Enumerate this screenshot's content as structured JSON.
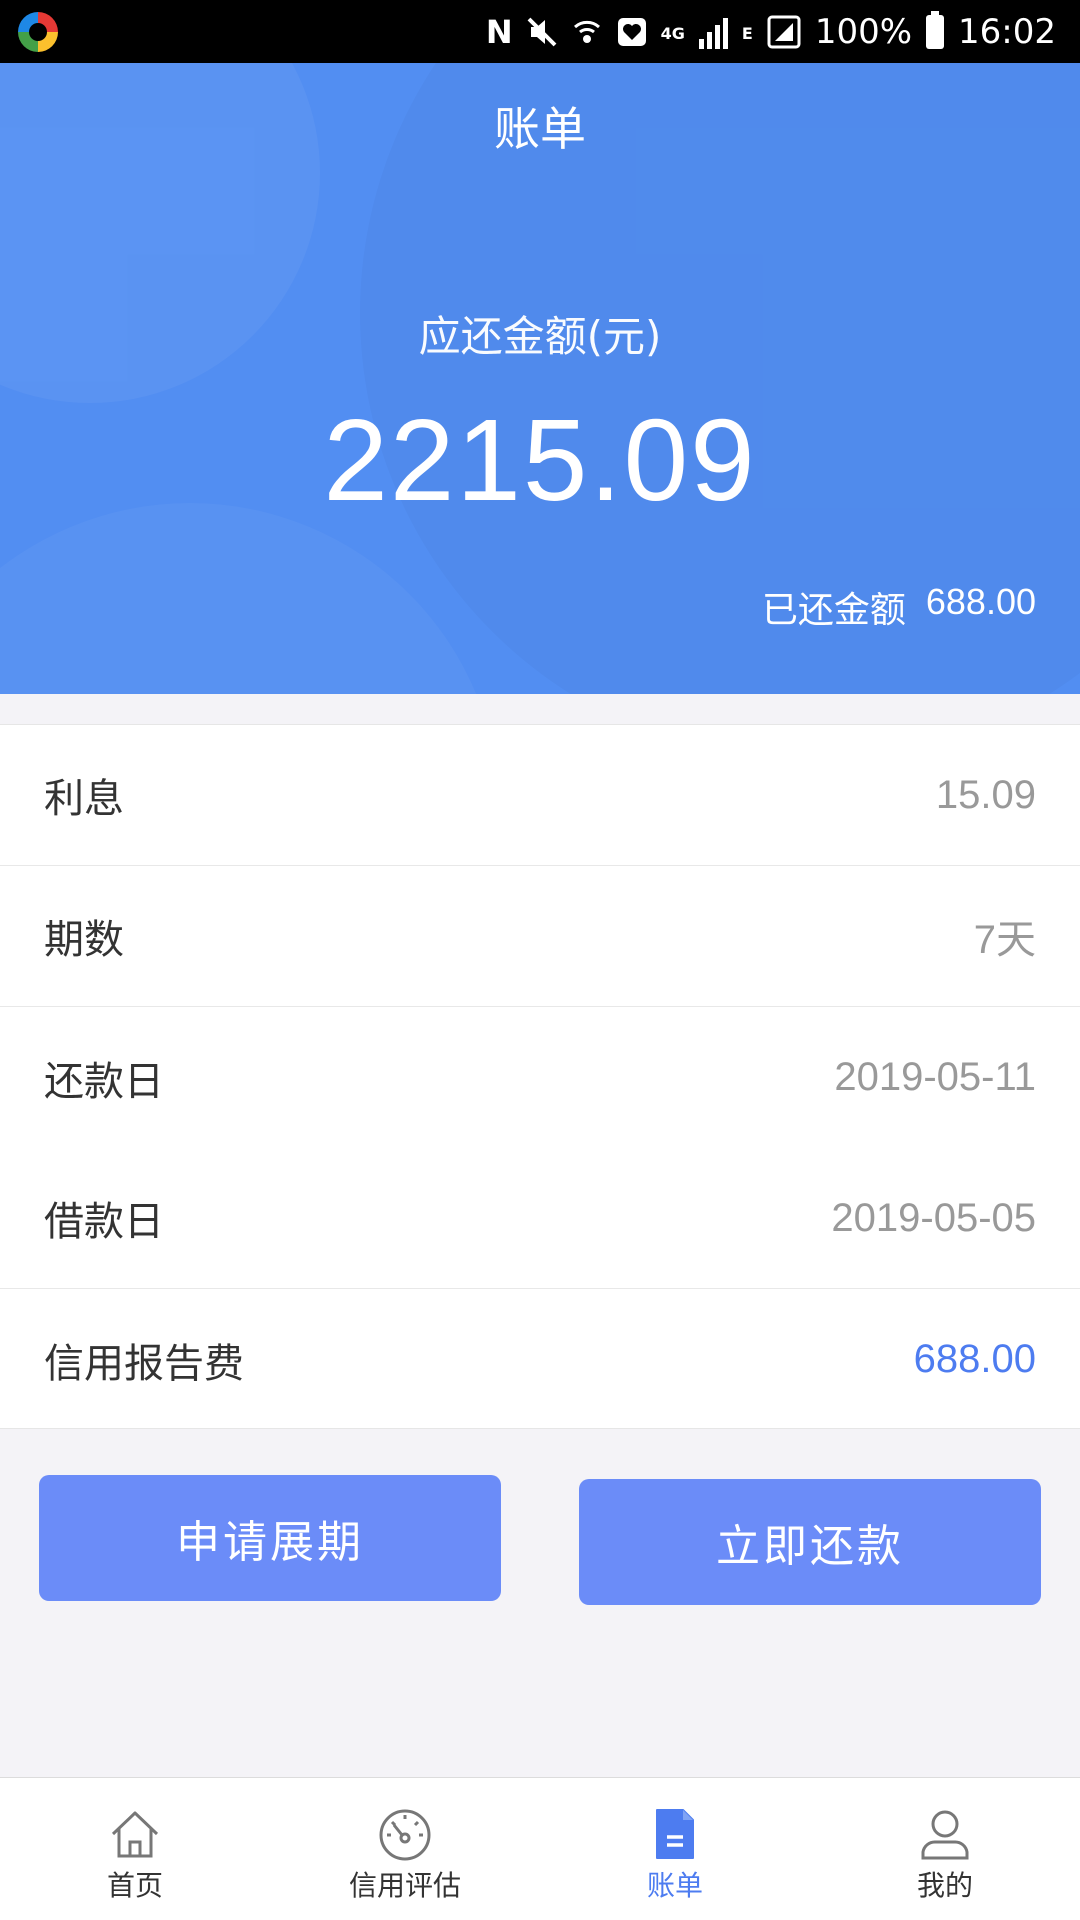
{
  "status_bar": {
    "battery": "100%",
    "time": "16:02",
    "network": "4G",
    "network_alt": "E"
  },
  "header": {
    "title": "账单",
    "amount_label": "应还金额(元)",
    "amount_value": "2215.09",
    "paid_label": "已还金额",
    "paid_value": "688.00",
    "background_color": "#528ef2"
  },
  "details": {
    "rows": [
      {
        "label": "利息",
        "value": "15.09"
      },
      {
        "label": "期数",
        "value": "7天"
      },
      {
        "label": "还款日",
        "value": "2019-05-11"
      },
      {
        "label": "借款日",
        "value": "2019-05-05"
      },
      {
        "label": "信用报告费",
        "value": "688.00"
      }
    ]
  },
  "actions": {
    "extend_label": "申请展期",
    "repay_label": "立即还款",
    "button_color": "#6b8cf8"
  },
  "bottom_nav": {
    "items": [
      {
        "label": "首页",
        "icon": "home-icon"
      },
      {
        "label": "信用评估",
        "icon": "gauge-icon"
      },
      {
        "label": "账单",
        "icon": "bill-icon",
        "active": true
      },
      {
        "label": "我的",
        "icon": "user-icon"
      }
    ],
    "active_color": "#4d7cf0"
  }
}
